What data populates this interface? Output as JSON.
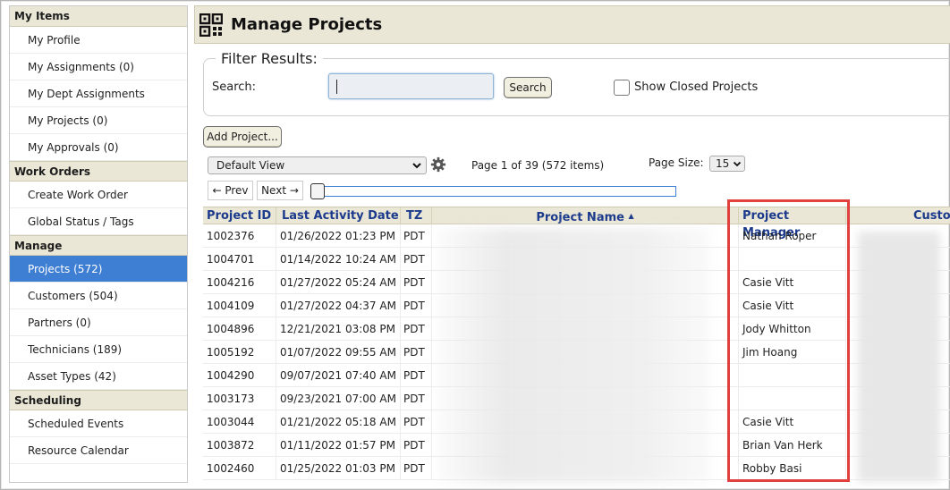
{
  "sidebar": {
    "sections": [
      {
        "title": "My Items",
        "items": [
          "My Profile",
          "My Assignments (0)",
          "My Dept Assignments",
          "My Projects (0)",
          "My Approvals (0)"
        ]
      },
      {
        "title": "Work Orders",
        "items": [
          "Create Work Order",
          "Global Status / Tags"
        ]
      },
      {
        "title": "Manage",
        "items": [
          "Projects (572)",
          "Customers (504)",
          "Partners (0)",
          "Technicians (189)",
          "Asset Types (42)"
        ]
      },
      {
        "title": "Scheduling",
        "items": [
          "Scheduled Events",
          "Resource Calendar"
        ]
      }
    ],
    "active_item": "Projects (572)"
  },
  "header": {
    "title": "Manage Projects"
  },
  "filter": {
    "legend": "Filter Results:",
    "search_label": "Search:",
    "search_value": "",
    "search_button": "Search",
    "show_closed_label": "Show Closed Projects",
    "show_closed_checked": false
  },
  "toolbar": {
    "add_button": "Add Project...",
    "view_select": "Default View",
    "page_info": "Page 1 of 39 (572 items)",
    "page_size_label": "Page Size:",
    "page_size_value": "15",
    "prev": "← Prev",
    "next": "Next →",
    "page_position": 1
  },
  "grid": {
    "columns": [
      "Project ID",
      "Last Activity Date",
      "TZ",
      "Project Name",
      "Project Manager",
      "Custo"
    ],
    "sort_indicator": "▲",
    "rows": [
      {
        "id": "1002376",
        "date": "01/26/2022 01:23 PM",
        "tz": "PDT",
        "pm": "Nathan Roper"
      },
      {
        "id": "1004701",
        "date": "01/14/2022 10:24 AM",
        "tz": "PDT",
        "pm": ""
      },
      {
        "id": "1004216",
        "date": "01/27/2022 05:24 AM",
        "tz": "PDT",
        "pm": "Casie Vitt"
      },
      {
        "id": "1004109",
        "date": "01/27/2022 04:37 AM",
        "tz": "PDT",
        "pm": "Casie Vitt"
      },
      {
        "id": "1004896",
        "date": "12/21/2021 03:08 PM",
        "tz": "PDT",
        "pm": "Jody Whitton"
      },
      {
        "id": "1005192",
        "date": "01/07/2022 09:55 AM",
        "tz": "PDT",
        "pm": "Jim Hoang"
      },
      {
        "id": "1004290",
        "date": "09/07/2021 07:40 AM",
        "tz": "PDT",
        "pm": ""
      },
      {
        "id": "1003173",
        "date": "09/23/2021 07:00 AM",
        "tz": "PDT",
        "pm": ""
      },
      {
        "id": "1003044",
        "date": "01/21/2022 05:18 AM",
        "tz": "PDT",
        "pm": "Casie Vitt"
      },
      {
        "id": "1003872",
        "date": "01/11/2022 01:57 PM",
        "tz": "PDT",
        "pm": "Brian Van Herk"
      },
      {
        "id": "1002460",
        "date": "01/25/2022 01:03 PM",
        "tz": "PDT",
        "pm": "Robby Basi"
      }
    ]
  },
  "colors": {
    "accent": "#3f7fd3",
    "header_bg": "#eae7d6",
    "highlight": "#e0403e",
    "column_text": "#1b3a8c"
  }
}
